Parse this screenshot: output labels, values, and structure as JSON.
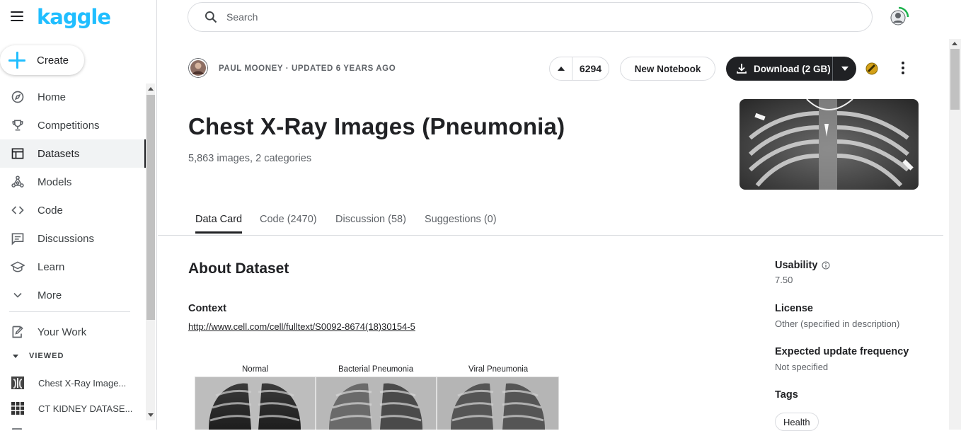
{
  "brand": {
    "logo_text": "kaggle",
    "accent": "#20beff"
  },
  "sidebar": {
    "create_label": "Create",
    "items": [
      {
        "label": "Home",
        "icon": "compass-icon"
      },
      {
        "label": "Competitions",
        "icon": "trophy-icon"
      },
      {
        "label": "Datasets",
        "icon": "table-icon",
        "active": true
      },
      {
        "label": "Models",
        "icon": "models-icon"
      },
      {
        "label": "Code",
        "icon": "code-icon"
      },
      {
        "label": "Discussions",
        "icon": "comments-icon"
      },
      {
        "label": "Learn",
        "icon": "school-icon"
      },
      {
        "label": "More",
        "icon": "chevron-down-icon"
      }
    ],
    "your_work_label": "Your Work",
    "viewed_label": "VIEWED",
    "viewed_items": [
      {
        "label": "Chest X-Ray Image..."
      },
      {
        "label": "CT KIDNEY DATASE..."
      }
    ]
  },
  "search": {
    "placeholder": "Search"
  },
  "dataset": {
    "owner_line": "PAUL MOONEY · UPDATED 6 YEARS AGO",
    "upvotes": "6294",
    "new_notebook_label": "New Notebook",
    "download_label": "Download (2 GB)",
    "title": "Chest X-Ray Images (Pneumonia)",
    "subtitle": "5,863 images, 2 categories"
  },
  "tabs": [
    {
      "label": "Data Card",
      "active": true
    },
    {
      "label": "Code (2470)"
    },
    {
      "label": "Discussion (58)"
    },
    {
      "label": "Suggestions (0)"
    }
  ],
  "content": {
    "about_heading": "About Dataset",
    "context_heading": "Context",
    "context_link": "http://www.cell.com/cell/fulltext/S0092-8674(18)30154-5",
    "figure_labels": [
      "Normal",
      "Bacterial Pneumonia",
      "Viral Pneumonia"
    ]
  },
  "side": {
    "usability_label": "Usability",
    "usability_value": "7.50",
    "license_label": "License",
    "license_value": "Other (specified in description)",
    "frequency_label": "Expected update frequency",
    "frequency_value": "Not specified",
    "tags_label": "Tags",
    "tags": [
      "Health"
    ]
  }
}
